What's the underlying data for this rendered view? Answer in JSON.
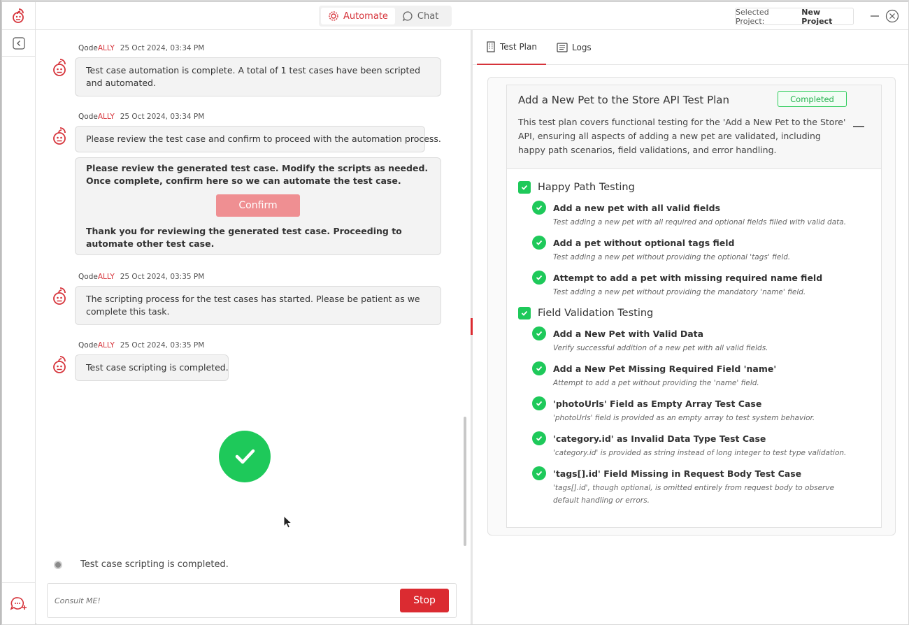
{
  "topbar": {
    "tabs": [
      {
        "label": "Automate",
        "active": true
      },
      {
        "label": "Chat",
        "active": false
      }
    ],
    "project_prefix": "Selected Project:",
    "project_name": "New Project"
  },
  "chat": {
    "messages": [
      {
        "sender_prefix": "Qode",
        "sender_suffix": "ALLY",
        "timestamp": "25 Oct 2024, 03:34 PM",
        "text": "Test case automation is complete. A total of 1 test cases have been scripted and automated."
      },
      {
        "sender_prefix": "Qode",
        "sender_suffix": "ALLY",
        "timestamp": "25 Oct 2024, 03:34 PM",
        "text": "Please review the test case and confirm to proceed with the automation process.",
        "card": {
          "intro": "Please review the generated test case. Modify the scripts as needed. Once complete, confirm here so we can automate the test case.",
          "button": "Confirm",
          "outro": "Thank you for reviewing the generated test case. Proceeding to automate other test case."
        }
      },
      {
        "sender_prefix": "Qode",
        "sender_suffix": "ALLY",
        "timestamp": "25 Oct 2024, 03:35 PM",
        "text": "The scripting process for the test cases has started. Please be patient as we complete this task."
      },
      {
        "sender_prefix": "Qode",
        "sender_suffix": "ALLY",
        "timestamp": "25 Oct 2024, 03:35 PM",
        "text": "Test case scripting is completed."
      }
    ],
    "status": "Test case scripting is completed.",
    "input_placeholder": "Consult ME!",
    "stop_label": "Stop"
  },
  "right": {
    "tabs": [
      {
        "label": "Test Plan",
        "active": true
      },
      {
        "label": "Logs",
        "active": false
      }
    ],
    "plan": {
      "title": "Add a New Pet to the Store API Test Plan",
      "status": "Completed",
      "description": "This test plan covers functional testing for the 'Add a New Pet to the Store' API, ensuring all aspects of adding a new pet are validated, including happy path scenarios, field validations, and error handling.",
      "sections": [
        {
          "title": "Happy Path Testing",
          "items": [
            {
              "title": "Add a new pet with all valid fields",
              "desc": "Test adding a new pet with all required and optional fields filled with valid data."
            },
            {
              "title": "Add a pet without optional tags field",
              "desc": "Test adding a new pet without providing the optional 'tags' field."
            },
            {
              "title": "Attempt to add a pet with missing required name field",
              "desc": "Test adding a new pet without providing the mandatory 'name' field."
            }
          ]
        },
        {
          "title": "Field Validation Testing",
          "items": [
            {
              "title": "Add a New Pet with Valid Data",
              "desc": "Verify successful addition of a new pet with all valid fields."
            },
            {
              "title": "Add a New Pet Missing Required Field 'name'",
              "desc": "Attempt to add a pet without providing the 'name' field."
            },
            {
              "title": "'photoUrls' Field as Empty Array Test Case",
              "desc": "'photoUrls' field is provided as an empty array to test system behavior."
            },
            {
              "title": "'category.id' as Invalid Data Type Test Case",
              "desc": "'category.id' is provided as string instead of long integer to test type validation."
            },
            {
              "title": "'tags[].id' Field Missing in Request Body Test Case",
              "desc": "'tags[].id', though optional, is omitted entirely from request body to observe default handling or errors."
            }
          ]
        }
      ]
    }
  },
  "colors": {
    "brand": "#d6333a",
    "success": "#1ec95a",
    "confirm_disabled": "#ef8f92",
    "stop": "#db2b31"
  }
}
